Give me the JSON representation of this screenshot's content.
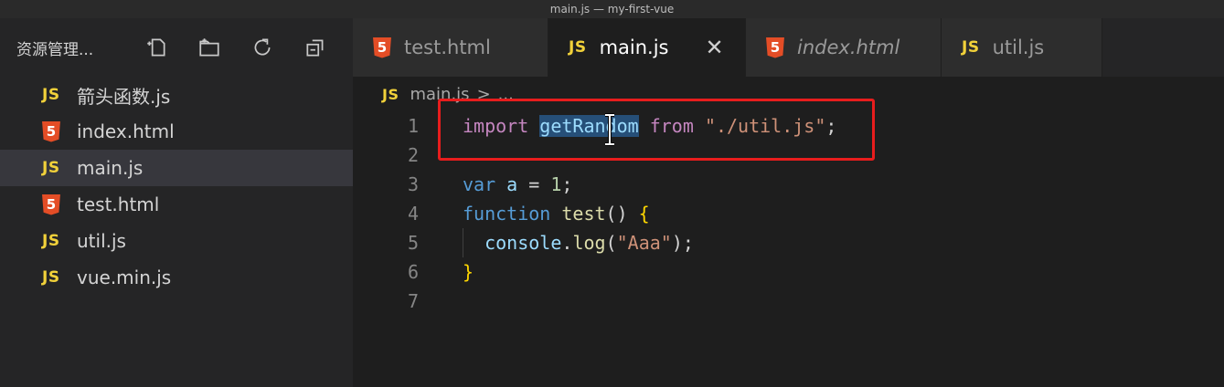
{
  "window": {
    "title": "main.js — my-first-vue"
  },
  "sidebar": {
    "title": "资源管理...",
    "actions": [
      {
        "name": "new-file-icon"
      },
      {
        "name": "new-folder-icon"
      },
      {
        "name": "refresh-icon"
      },
      {
        "name": "collapse-all-icon"
      }
    ],
    "files": [
      {
        "name": "箭头函数.js",
        "type": "js",
        "badge": "JS",
        "active": false
      },
      {
        "name": "index.html",
        "type": "html",
        "badge": "5",
        "active": false
      },
      {
        "name": "main.js",
        "type": "js",
        "badge": "JS",
        "active": true
      },
      {
        "name": "test.html",
        "type": "html",
        "badge": "5",
        "active": false
      },
      {
        "name": "util.js",
        "type": "js",
        "badge": "JS",
        "active": false
      },
      {
        "name": "vue.min.js",
        "type": "js",
        "badge": "JS",
        "active": false
      }
    ]
  },
  "tabs": [
    {
      "label": "test.html",
      "type": "html",
      "badge": "5",
      "active": false,
      "italic": false
    },
    {
      "label": "main.js",
      "type": "js",
      "badge": "JS",
      "active": true,
      "italic": false,
      "close": "✕"
    },
    {
      "label": "index.html",
      "type": "html",
      "badge": "5",
      "active": false,
      "italic": true
    },
    {
      "label": "util.js",
      "type": "js",
      "badge": "JS",
      "active": false,
      "italic": false
    }
  ],
  "breadcrumb": {
    "badge": "JS",
    "file": "main.js",
    "separator": ">",
    "rest": "..."
  },
  "editor": {
    "lines": [
      {
        "number": "1",
        "tokens": [
          {
            "t": "import",
            "c": "kw-imp"
          },
          {
            "t": " ",
            "c": "punc"
          },
          {
            "t": "getRandom",
            "c": "sel"
          },
          {
            "t": " ",
            "c": "punc"
          },
          {
            "t": "from",
            "c": "kw-imp"
          },
          {
            "t": " ",
            "c": "punc"
          },
          {
            "t": "\"./util.js\"",
            "c": "str"
          },
          {
            "t": ";",
            "c": "punc"
          }
        ]
      },
      {
        "number": "2",
        "tokens": []
      },
      {
        "number": "3",
        "tokens": [
          {
            "t": "var",
            "c": "kw"
          },
          {
            "t": " ",
            "c": "punc"
          },
          {
            "t": "a",
            "c": "id"
          },
          {
            "t": " = ",
            "c": "punc"
          },
          {
            "t": "1",
            "c": "num"
          },
          {
            "t": ";",
            "c": "punc"
          }
        ]
      },
      {
        "number": "4",
        "tokens": [
          {
            "t": "function",
            "c": "kw"
          },
          {
            "t": " ",
            "c": "punc"
          },
          {
            "t": "test",
            "c": "fn"
          },
          {
            "t": "() ",
            "c": "punc"
          },
          {
            "t": "{",
            "c": "brace"
          }
        ]
      },
      {
        "number": "5",
        "indent": true,
        "tokens": [
          {
            "t": "  ",
            "c": "punc"
          },
          {
            "t": "console",
            "c": "id"
          },
          {
            "t": ".",
            "c": "punc"
          },
          {
            "t": "log",
            "c": "fn"
          },
          {
            "t": "(",
            "c": "punc"
          },
          {
            "t": "\"Aaa\"",
            "c": "str"
          },
          {
            "t": ");",
            "c": "punc"
          }
        ]
      },
      {
        "number": "6",
        "tokens": [
          {
            "t": "}",
            "c": "brace"
          }
        ]
      },
      {
        "number": "7",
        "tokens": []
      }
    ]
  },
  "colors": {
    "highlight_box": "#e81d1d",
    "selection": "#264f78",
    "js_badge": "#f1d13a",
    "html_badge": "#e44d26"
  }
}
